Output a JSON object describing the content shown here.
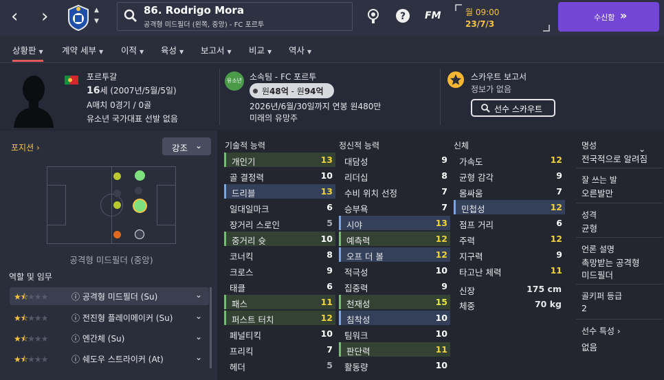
{
  "header": {
    "player_title": "86. Rodrigo Mora",
    "player_subtitle": "공격형 미드필더 (왼쪽, 중앙) - FC 포르투",
    "brand": "FM",
    "day_time": "월 09:00",
    "date": "23/7/3",
    "inbox_label": "수신함",
    "inbox_icon": "double-chevron-right-icon"
  },
  "tabs": [
    {
      "label": "상황판",
      "active": true
    },
    {
      "label": "계약 세부",
      "active": false
    },
    {
      "label": "이적",
      "active": false
    },
    {
      "label": "육성",
      "active": false
    },
    {
      "label": "보고서",
      "active": false
    },
    {
      "label": "비교",
      "active": false
    },
    {
      "label": "역사",
      "active": false
    }
  ],
  "profile": {
    "nationality": "포르투갈",
    "age": "16",
    "age_suffix": "세",
    "birth": " (2007년/5월/5일)",
    "a_caps": "A매치 0경기 / 0골",
    "youth": "유소년 국가대표 선발 없음",
    "club": "소속팀 - FC 포르투",
    "youth_badge": "유소년",
    "value_prefix": "원",
    "value_low": "48억",
    "value_sep": " - ",
    "value_prefix2": "원",
    "value_high": "94억",
    "contract": "2026년/6월/30일까지 연봉 원480만",
    "potential": "미래의 유망주",
    "scout_title": "스카우트 보고서",
    "scout_info": "정보가 없음",
    "scout_button": "선수 스카우트",
    "accent": "#f6c444"
  },
  "left": {
    "position_link": "포지션",
    "highlight_label": "강조",
    "position_caption": "공격형 미드필더 (중앙)",
    "roles_title": "역할 및 임무",
    "roles": [
      {
        "name": "공격형 미드필더 (Su)",
        "stars": 1.5
      },
      {
        "name": "전진형 플레이메이커 (Su)",
        "stars": 1.5
      },
      {
        "name": "엔간체 (Su)",
        "stars": 1.5
      },
      {
        "name": "쉐도우 스트라이커 (At)",
        "stars": 1.5
      }
    ]
  },
  "attributes": {
    "technical_title": "기술적 능력",
    "mental_title": "정신적 능력",
    "physical_title": "신체",
    "technical": [
      {
        "name": "개인기",
        "value": "13",
        "hl": "green"
      },
      {
        "name": "골 결정력",
        "value": "10",
        "hl": ""
      },
      {
        "name": "드리블",
        "value": "13",
        "hl": "blue"
      },
      {
        "name": "일대일마크",
        "value": "6",
        "hl": ""
      },
      {
        "name": "장거리 스로인",
        "value": "5",
        "hl": ""
      },
      {
        "name": "중거리 슛",
        "value": "10",
        "hl": "green"
      },
      {
        "name": "코너킥",
        "value": "8",
        "hl": ""
      },
      {
        "name": "크로스",
        "value": "9",
        "hl": ""
      },
      {
        "name": "태클",
        "value": "6",
        "hl": ""
      },
      {
        "name": "패스",
        "value": "11",
        "hl": "green"
      },
      {
        "name": "퍼스트 터치",
        "value": "12",
        "hl": "green"
      },
      {
        "name": "페널티킥",
        "value": "10",
        "hl": ""
      },
      {
        "name": "프리킥",
        "value": "7",
        "hl": ""
      },
      {
        "name": "헤더",
        "value": "5",
        "hl": ""
      }
    ],
    "mental": [
      {
        "name": "대담성",
        "value": "9",
        "hl": ""
      },
      {
        "name": "리더십",
        "value": "8",
        "hl": ""
      },
      {
        "name": "수비 위치 선정",
        "value": "7",
        "hl": ""
      },
      {
        "name": "승부욕",
        "value": "7",
        "hl": ""
      },
      {
        "name": "시야",
        "value": "13",
        "hl": "blue"
      },
      {
        "name": "예측력",
        "value": "12",
        "hl": "green"
      },
      {
        "name": "오프 더 볼",
        "value": "12",
        "hl": "blue"
      },
      {
        "name": "적극성",
        "value": "10",
        "hl": ""
      },
      {
        "name": "집중력",
        "value": "9",
        "hl": ""
      },
      {
        "name": "천재성",
        "value": "15",
        "hl": "green"
      },
      {
        "name": "침착성",
        "value": "10",
        "hl": "blue"
      },
      {
        "name": "팀워크",
        "value": "10",
        "hl": ""
      },
      {
        "name": "판단력",
        "value": "11",
        "hl": "green"
      },
      {
        "name": "활동량",
        "value": "10",
        "hl": ""
      }
    ],
    "physical": [
      {
        "name": "가속도",
        "value": "12",
        "hl": ""
      },
      {
        "name": "균형 감각",
        "value": "9",
        "hl": ""
      },
      {
        "name": "몸싸움",
        "value": "7",
        "hl": ""
      },
      {
        "name": "민첩성",
        "value": "12",
        "hl": "blue"
      },
      {
        "name": "점프 거리",
        "value": "6",
        "hl": ""
      },
      {
        "name": "주력",
        "value": "12",
        "hl": ""
      },
      {
        "name": "지구력",
        "value": "9",
        "hl": ""
      },
      {
        "name": "타고난 체력",
        "value": "11",
        "hl": ""
      }
    ],
    "height_label": "신장",
    "height_value": "175 cm",
    "weight_label": "체중",
    "weight_value": "70 kg"
  },
  "info": {
    "reputation_label": "명성",
    "reputation_value": "전국적으로 알려짐",
    "foot_label": "잘 쓰는 발",
    "foot_value": "오른발만",
    "personality_label": "성격",
    "personality_value": "균형",
    "media_label": "언론 설명",
    "media_value1": "촉망받는 공격형",
    "media_value2": "미드필더",
    "gk_label": "골키퍼 등급",
    "gk_value": "2",
    "traits_label": "선수 특성",
    "traits_value": "없음"
  }
}
